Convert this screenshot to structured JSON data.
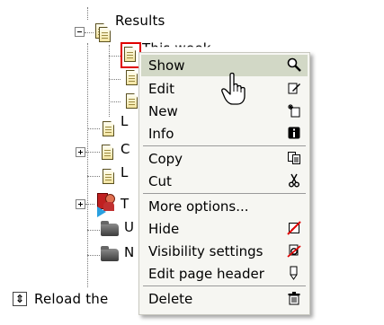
{
  "tree": {
    "results_label": "Results",
    "this_week_label": "This week",
    "partial_labels": [
      "L",
      "C",
      "L",
      "T",
      "U",
      "N"
    ]
  },
  "footer": {
    "reload_label": "Reload the"
  },
  "context_menu": {
    "items": [
      {
        "label": "Show",
        "icon": "magnifier-icon",
        "highlighted": true
      },
      {
        "label": "Edit",
        "icon": "edit-icon"
      },
      {
        "label": "New",
        "icon": "new-icon"
      },
      {
        "label": "Info",
        "icon": "info-icon"
      },
      {
        "label": "Copy",
        "icon": "copy-icon"
      },
      {
        "label": "Cut",
        "icon": "scissors-icon"
      },
      {
        "label": "More options...",
        "icon": ""
      },
      {
        "label": "Hide",
        "icon": "hide-icon"
      },
      {
        "label": "Visibility settings",
        "icon": "visibility-icon"
      },
      {
        "label": "Edit page header",
        "icon": "pencil-icon"
      },
      {
        "label": "Delete",
        "icon": "trash-icon"
      }
    ]
  },
  "colors": {
    "highlight": "#d2d8c6",
    "selection_border": "#e00000",
    "menu_background": "#f6f6f2"
  }
}
